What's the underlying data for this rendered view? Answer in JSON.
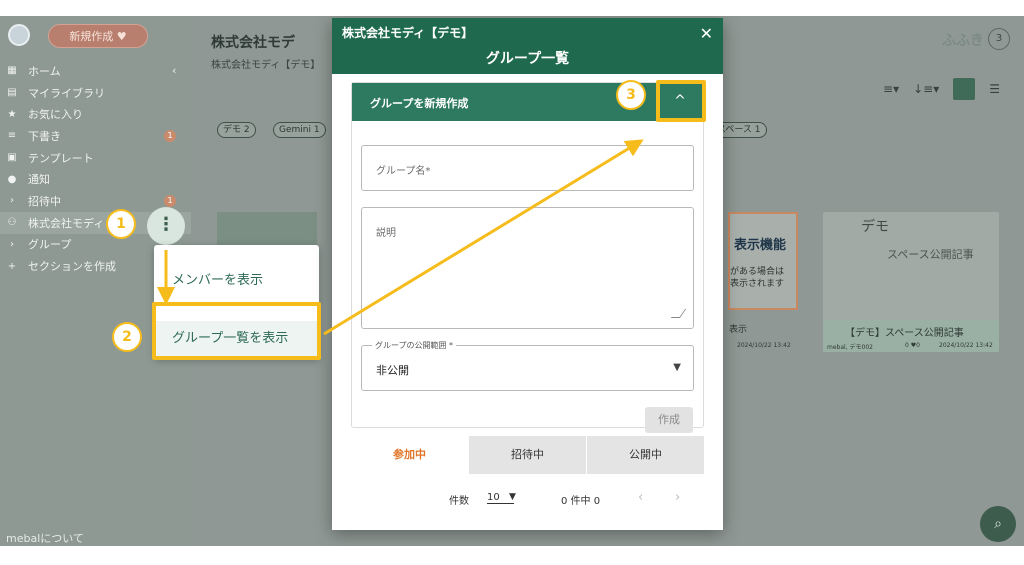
{
  "sidebar": {
    "new_button": "新規作成 ♥",
    "items": [
      {
        "icon": "▦",
        "label": "ホーム",
        "badge": "",
        "chevron": "‹"
      },
      {
        "icon": "▤",
        "label": "マイライブラリ",
        "badge": "",
        "chevron": ""
      },
      {
        "icon": "★",
        "label": "お気に入り",
        "badge": "",
        "chevron": ""
      },
      {
        "icon": "≡",
        "label": "下書き",
        "badge": "1",
        "chevron": ""
      },
      {
        "icon": "▣",
        "label": "テンプレート",
        "badge": "",
        "chevron": ""
      },
      {
        "icon": "●",
        "label": "通知",
        "badge": "",
        "chevron": ""
      },
      {
        "icon": "›",
        "label": "招待中",
        "badge": "1",
        "chevron": ""
      },
      {
        "icon": "⚇",
        "label": "株式会社モディ",
        "badge": "",
        "chevron": ""
      },
      {
        "icon": "›",
        "label": "グループ",
        "badge": "",
        "chevron": ""
      },
      {
        "icon": "+",
        "label": "セクションを作成",
        "badge": "",
        "chevron": ""
      }
    ],
    "footer": "mebalについて"
  },
  "main": {
    "title": "株式会社モデ",
    "subtitle": "株式会社モディ【デモ】",
    "chips": [
      "デモ 2",
      "Gemini 1",
      "スペース 1"
    ],
    "brand": "ふふき",
    "brand_count": "3",
    "cards": {
      "orange_title": "表示機能",
      "orange_line1": "がある場合は",
      "orange_line2": "表示されます",
      "right_title": "デモ",
      "right_sub": "スペース公開記事",
      "right_foot_title": "【デモ】スペース公開記事",
      "right_meta": "mebal, デモ002",
      "right_date": "2024/10/22 13:42",
      "mid_foot": "表示",
      "mid_date": "2024/10/22 13:42",
      "right_stats": "0 ♥0"
    }
  },
  "context_menu": {
    "items": [
      "メンバーを表示",
      "グループ一覧を表示"
    ]
  },
  "modal": {
    "company": "株式会社モディ【デモ】",
    "title": "グループ一覧",
    "close": "✕",
    "form": {
      "header_label": "グループを新規作成",
      "toggle_icon": "^",
      "name_placeholder": "グループ名*",
      "desc_placeholder": "説明",
      "scope_legend": "グループの公開範囲 *",
      "scope_value": "非公開",
      "create_button": "作成"
    },
    "tabs": [
      "参加中",
      "招待中",
      "公開中"
    ],
    "pager": {
      "label": "件数",
      "per_page": "10",
      "count": "0 件中 0",
      "prev": "‹",
      "next": "›"
    }
  },
  "annotations": [
    "1",
    "2",
    "3"
  ],
  "colors": {
    "accent_green": "#1f6a4f",
    "highlight_yellow": "#f5bc1b",
    "tab_active": "#e0752a"
  }
}
